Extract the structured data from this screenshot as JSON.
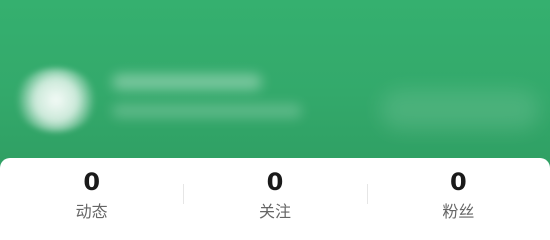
{
  "header": {
    "icons": {
      "settings": "hexagon-settings-icon",
      "notifications": "bell-icon",
      "add": "plus-icon"
    },
    "highlight_color": "#c04a52",
    "background_color": "#33a96b"
  },
  "stats": [
    {
      "count": "0",
      "label": "动态"
    },
    {
      "count": "0",
      "label": "关注"
    },
    {
      "count": "0",
      "label": "粉丝"
    }
  ]
}
